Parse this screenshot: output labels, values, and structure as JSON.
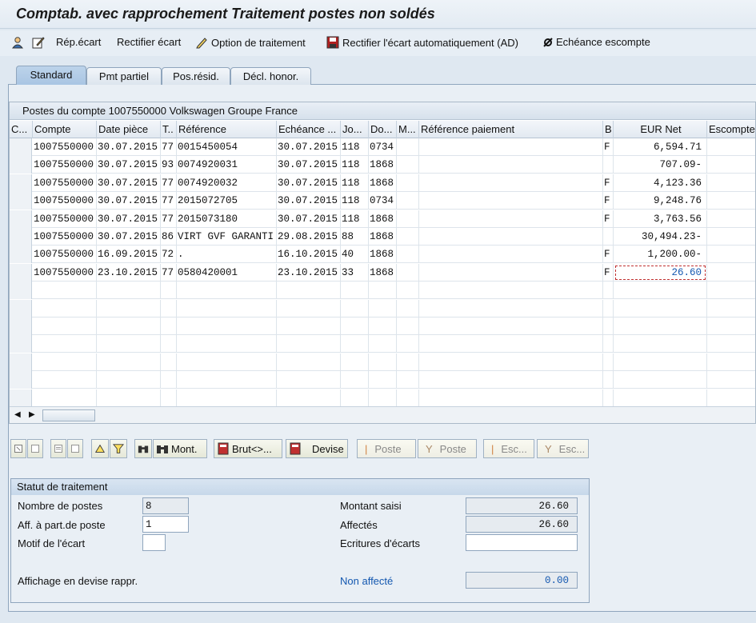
{
  "title": "Comptab. avec rapprochement Traitement postes non soldés",
  "toolbar": {
    "rep_ecart": "Rép.écart",
    "rectifier_ecart": "Rectifier écart",
    "option_traitement": "Option de traitement",
    "rectifier_auto": "Rectifier l'écart automatiquement (AD)",
    "echeance_escompte": "Echéance escompte"
  },
  "tabs": [
    "Standard",
    "Pmt partiel",
    "Pos.résid.",
    "Décl. honor."
  ],
  "grid": {
    "title": "Postes du compte 1007550000 Volkswagen Groupe France",
    "columns": [
      "C...",
      "Compte",
      "Date pièce",
      "T..",
      "Référence",
      "Echéance ...",
      "Jo...",
      "Do...",
      "M...",
      "Référence paiement",
      "B",
      "EUR Net",
      "Escompte"
    ],
    "rows": [
      [
        "",
        "1007550000",
        "30.07.2015",
        "77",
        "0015450054",
        "30.07.2015",
        "118",
        "0734",
        "",
        "",
        "F",
        "6,594.71",
        ""
      ],
      [
        "",
        "1007550000",
        "30.07.2015",
        "93",
        "0074920031",
        "30.07.2015",
        "118",
        "1868",
        "",
        "",
        "",
        "707.09-",
        ""
      ],
      [
        "",
        "1007550000",
        "30.07.2015",
        "77",
        "0074920032",
        "30.07.2015",
        "118",
        "1868",
        "",
        "",
        "F",
        "4,123.36",
        ""
      ],
      [
        "",
        "1007550000",
        "30.07.2015",
        "77",
        "2015072705",
        "30.07.2015",
        "118",
        "0734",
        "",
        "",
        "F",
        "9,248.76",
        ""
      ],
      [
        "",
        "1007550000",
        "30.07.2015",
        "77",
        "2015073180",
        "30.07.2015",
        "118",
        "1868",
        "",
        "",
        "F",
        "3,763.56",
        ""
      ],
      [
        "",
        "1007550000",
        "30.07.2015",
        "86",
        "VIRT GVF GARANTI",
        "29.08.2015",
        "88",
        "1868",
        "",
        "",
        "",
        "30,494.23-",
        ""
      ],
      [
        "",
        "1007550000",
        "16.09.2015",
        "72",
        ".",
        "16.10.2015",
        "40",
        "1868",
        "",
        "",
        "F",
        "1,200.00-",
        ""
      ],
      [
        "",
        "1007550000",
        "23.10.2015",
        "77",
        "0580420001",
        "23.10.2015",
        "33",
        "1868",
        "",
        "",
        "F",
        "26.60",
        ""
      ]
    ]
  },
  "buttons": {
    "mont": "Mont.",
    "brut": "Brut<>...",
    "devise": "Devise",
    "poste1": "Poste",
    "poste2": "Poste",
    "esc1": "Esc...",
    "esc2": "Esc..."
  },
  "status": {
    "title": "Statut de traitement",
    "nombre_postes_label": "Nombre de postes",
    "nombre_postes": "8",
    "aff_part_label": "Aff. à part.de poste",
    "aff_part": "1",
    "motif_label": "Motif de l'écart",
    "motif": "",
    "affichage_label": "Affichage en devise rappr.",
    "montant_saisi_label": "Montant saisi",
    "montant_saisi": "26.60",
    "affectes_label": "Affectés",
    "affectes": "26.60",
    "ecritures_label": "Ecritures d'écarts",
    "ecritures": "",
    "non_affecte_label": "Non affecté",
    "non_affecte": "0.00"
  }
}
